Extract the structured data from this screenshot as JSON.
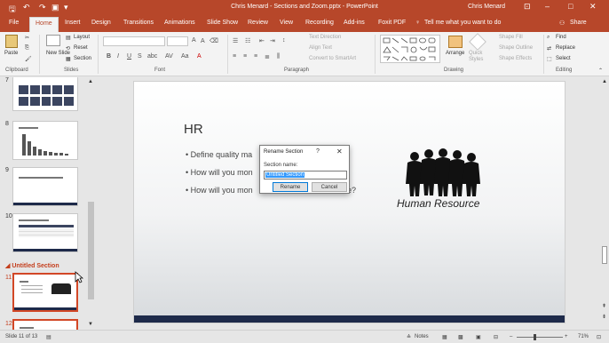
{
  "window": {
    "title": "Chris Menard - Sections and Zoom.pptx - PowerPoint",
    "user": "Chris Menard"
  },
  "tabs": [
    "File",
    "Home",
    "Insert",
    "Design",
    "Transitions",
    "Animations",
    "Slide Show",
    "Review",
    "View",
    "Recording",
    "Add-ins",
    "Foxit PDF"
  ],
  "tell_me": "Tell me what you want to do",
  "share": "Share",
  "ribbon": {
    "clipboard": {
      "paste": "Paste",
      "label": "Clipboard"
    },
    "slides": {
      "new_slide": "New Slide",
      "layout": "Layout",
      "reset": "Reset",
      "section": "Section",
      "label": "Slides"
    },
    "font": {
      "label": "Font"
    },
    "paragraph": {
      "text_direction": "Text Direction",
      "align_text": "Align Text",
      "convert_smartart": "Convert to SmartArt",
      "label": "Paragraph"
    },
    "drawing": {
      "arrange": "Arrange",
      "quick_styles": "Quick Styles",
      "shape_fill": "Shape Fill",
      "shape_outline": "Shape Outline",
      "shape_effects": "Shape Effects",
      "label": "Drawing"
    },
    "editing": {
      "find": "Find",
      "replace": "Replace",
      "select": "Select",
      "label": "Editing"
    }
  },
  "thumbnails": [
    {
      "num": "7"
    },
    {
      "num": "8"
    },
    {
      "num": "9"
    },
    {
      "num": "10"
    },
    {
      "num": "11"
    },
    {
      "num": "12"
    }
  ],
  "section_header": "Untitled Section",
  "slide": {
    "title": "HR",
    "bullets": [
      "Define quality ma",
      "How will you mon",
      "How will you mon"
    ],
    "bullet_tail": "e?",
    "logo_text": "Human Resource"
  },
  "dialog": {
    "title": "Rename Section",
    "help": "?",
    "close": "✕",
    "field_label": "Section name:",
    "field_value": "Untitled Section",
    "rename_button": "Rename",
    "cancel_button": "Cancel"
  },
  "status": {
    "slide_info": "Slide 11 of 13",
    "notes": "Notes",
    "zoom": "71%"
  },
  "colors": {
    "accent": "#b7472a",
    "section": "#c43e1c",
    "band": "#1e2a4a"
  }
}
